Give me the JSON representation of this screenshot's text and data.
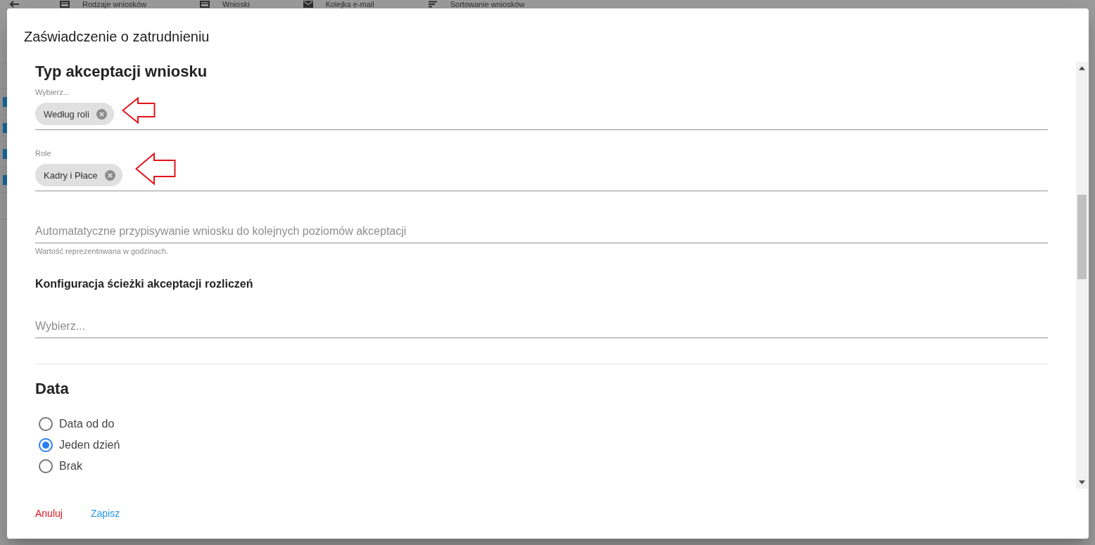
{
  "background": {
    "nav_tabs": [
      "Rodzaje wniosków",
      "Wnioski",
      "Kolejka e-mail",
      "Sortowanie wniosków"
    ],
    "rows": [
      {
        "selected": false
      },
      {
        "selected": true
      },
      {
        "selected": true
      },
      {
        "selected": true
      },
      {
        "selected": true
      },
      {
        "selected": false
      }
    ]
  },
  "dialog": {
    "title": "Zaświadczenie o zatrudnieniu",
    "heading": "Typ akceptacji wniosku",
    "acceptance_type": {
      "label": "Wybierz...",
      "chips": [
        "Według roli"
      ],
      "annotated": true
    },
    "roles": {
      "label": "Role",
      "chips": [
        "Kadry i Płace"
      ],
      "annotated": true
    },
    "auto_assign": {
      "placeholder": "Automatatyczne przypisywanie wniosku do kolejnych poziomów akceptacji",
      "hint": "Wartość reprezentowana w godzinach."
    },
    "settlement_heading": "Konfiguracja ścieżki akceptacji rozliczeń",
    "settlement_path": {
      "placeholder": "Wybierz..."
    },
    "date_heading": "Data",
    "date_options": [
      {
        "label": "Data od do",
        "selected": false
      },
      {
        "label": "Jeden dzień",
        "selected": true
      },
      {
        "label": "Brak",
        "selected": false
      }
    ],
    "actions": [
      {
        "label": "Anuluj",
        "kind": "cancel"
      },
      {
        "label": "Zapisz",
        "kind": "save"
      }
    ]
  }
}
